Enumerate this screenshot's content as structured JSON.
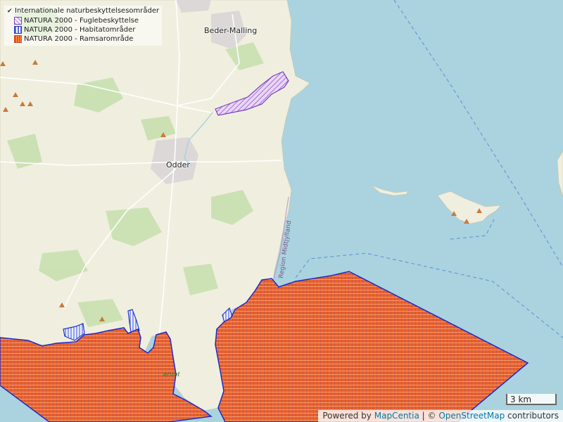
{
  "legend": {
    "group_label": "Internationale naturbeskyttelsesområder",
    "items": [
      {
        "label": "NATURA 2000 - Fuglebeskyttelse",
        "color": "#7b3fbf"
      },
      {
        "label": "NATURA 2000 - Habitatområder",
        "color": "#2238c4"
      },
      {
        "label": "NATURA 2000 - Ramsarområde",
        "color": "#e8501e"
      }
    ]
  },
  "places": {
    "town_1": "Beder-Malling",
    "town_2": "Odder",
    "region": "Region Midtjylland",
    "reserve": "ervot"
  },
  "scale": {
    "label": "3 km"
  },
  "attribution": {
    "prefix": "Powered by",
    "link1": "MapCentia",
    "sep": "| ©",
    "link2": "OpenStreetMap",
    "suffix": "contributors"
  },
  "colors": {
    "sea": "#aad3df",
    "land": "#f0efdf",
    "forest": "#c8e0b0",
    "town": "#dcd8d8"
  }
}
